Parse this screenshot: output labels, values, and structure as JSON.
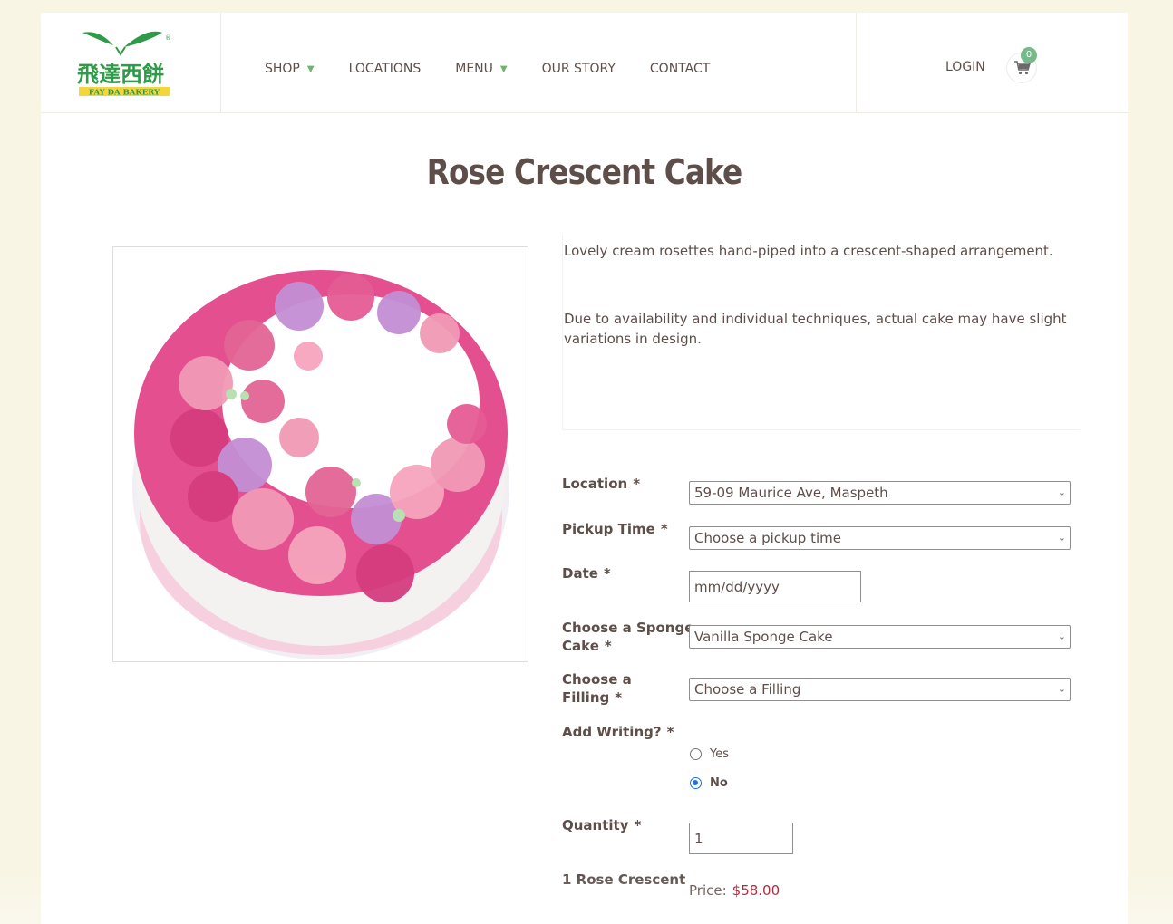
{
  "brand": {
    "chinese_name": "飛達西餅",
    "english_name": "FAY DA BAKERY",
    "registered_mark": "®"
  },
  "nav": {
    "items": [
      {
        "label": "SHOP",
        "has_dropdown": true
      },
      {
        "label": "LOCATIONS",
        "has_dropdown": false
      },
      {
        "label": "MENU",
        "has_dropdown": true
      },
      {
        "label": "OUR STORY",
        "has_dropdown": false
      },
      {
        "label": "CONTACT",
        "has_dropdown": false
      }
    ],
    "caret": "▼",
    "login_label": "LOGIN",
    "cart_count": "0",
    "cart_icon": "cart-icon"
  },
  "product": {
    "title": "Rose Crescent Cake",
    "description_1": "Lovely cream rosettes hand-piped into a crescent-shaped arrangement.",
    "description_2": "Due to availability and individual techniques, actual cake may have slight variations in design."
  },
  "form": {
    "required_mark": "*",
    "location_label": "Location",
    "location_value": "59-09 Maurice Ave, Maspeth",
    "pickup_label": "Pickup Time",
    "pickup_value": "Choose a pickup time",
    "date_label": "Date",
    "date_placeholder": "mm/dd/yyyy",
    "sponge_label_1": "Choose a Sponge",
    "sponge_label_2": "Cake",
    "sponge_value": "Vanilla Sponge Cake",
    "filling_label_1": "Choose a",
    "filling_label_2": "Filling",
    "filling_value": "Choose a Filling",
    "writing_label": "Add Writing?",
    "writing_options": [
      {
        "label": "Yes",
        "selected": false
      },
      {
        "label": "No",
        "selected": true
      }
    ],
    "quantity_label": "Quantity",
    "quantity_value": "1",
    "summary_label": "1 Rose Crescent",
    "price_label": "Price:",
    "price_value": "$58.00"
  },
  "colors": {
    "page_bg": "#f8f5e4",
    "text": "#5e4e4a",
    "accent_green": "#6fb36f",
    "price_red": "#a30f1f",
    "radio_blue": "#1a73e8"
  }
}
